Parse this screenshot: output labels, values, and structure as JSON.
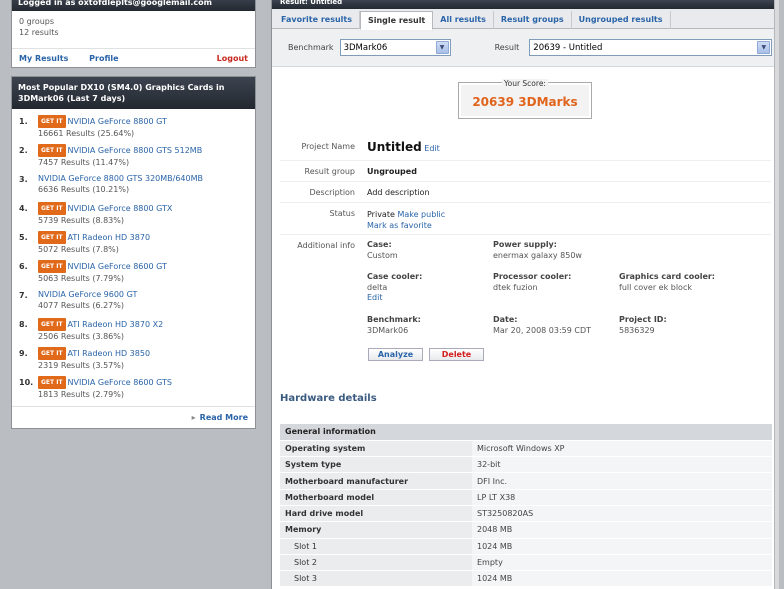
{
  "user": {
    "logged_in_text": "Logged in as oxtofdleplts@googlemail.com",
    "groups": "0 groups",
    "results": "12 results",
    "my_results": "My Results",
    "profile": "Profile",
    "logout": "Logout"
  },
  "popular": {
    "title_line1": "Most Popular DX10 (SM4.0) Graphics Cards in",
    "title_line2": "3DMark06 (Last 7 days)",
    "getit_label": "GET IT",
    "items": [
      {
        "num": "1.",
        "name": "NVIDIA GeForce 8800 GT",
        "count": "16661 Results (25.64%)",
        "getit": true
      },
      {
        "num": "2.",
        "name": "NVIDIA GeForce 8800 GTS 512MB",
        "count": "7457 Results (11.47%)",
        "getit": true
      },
      {
        "num": "3.",
        "name": "NVIDIA GeForce 8800 GTS 320MB/640MB",
        "count": "6636 Results (10.21%)",
        "getit": false
      },
      {
        "num": "4.",
        "name": "NVIDIA GeForce 8800 GTX",
        "count": "5739 Results (8.83%)",
        "getit": true
      },
      {
        "num": "5.",
        "name": "ATI Radeon HD 3870",
        "count": "5072 Results (7.8%)",
        "getit": true
      },
      {
        "num": "6.",
        "name": "NVIDIA GeForce 8600 GT",
        "count": "5063 Results (7.79%)",
        "getit": true
      },
      {
        "num": "7.",
        "name": "NVIDIA GeForce 9600 GT",
        "count": "4077 Results (6.27%)",
        "getit": false
      },
      {
        "num": "8.",
        "name": "ATI Radeon HD 3870 X2",
        "count": "2506 Results (3.86%)",
        "getit": true
      },
      {
        "num": "9.",
        "name": "ATI Radeon HD 3850",
        "count": "2319 Results (3.57%)",
        "getit": true
      },
      {
        "num": "10.",
        "name": "NVIDIA GeForce 8600 GTS",
        "count": "1813 Results (2.79%)",
        "getit": true
      }
    ],
    "read_more": "Read More"
  },
  "result": {
    "window_title": "Result: Untitled",
    "tabs": [
      "Favorite results",
      "Single result",
      "All results",
      "Result groups",
      "Ungrouped results"
    ],
    "active_tab": "Single result",
    "benchmark_label": "Benchmark",
    "benchmark_value": "3DMark06",
    "result_label": "Result",
    "result_value": "20639 - Untitled",
    "score_label": "Your Score:",
    "score_value": "20639 3DMarks",
    "project_name_label": "Project Name",
    "project_name": "Untitled",
    "edit": "Edit",
    "result_group_label": "Result group",
    "result_group": "Ungrouped",
    "description_label": "Description",
    "add_description": "Add description",
    "status_label": "Status",
    "status_value": "Private",
    "make_public": "Make public",
    "mark_favorite": "Mark as favorite",
    "additional_info_label": "Additional info",
    "case_k": "Case:",
    "case_v": "Custom",
    "psu_k": "Power supply:",
    "psu_v": "enermax galaxy 850w",
    "cooler_k": "Case cooler:",
    "cooler_v": "delta",
    "cooler_edit": "Edit",
    "cpu_cooler_k": "Processor cooler:",
    "cpu_cooler_v": "dtek fuzion",
    "gpu_cooler_k": "Graphics card cooler:",
    "gpu_cooler_v": "full cover ek block",
    "bench_k": "Benchmark:",
    "bench_v": "3DMark06",
    "date_k": "Date:",
    "date_v": "Mar 20, 2008 03:59 CDT",
    "pid_k": "Project ID:",
    "pid_v": "5836329",
    "analyze": "Analyze",
    "delete": "Delete"
  },
  "hardware": {
    "title": "Hardware details",
    "section": "General information",
    "rows": [
      {
        "k": "Operating system",
        "v": "Microsoft Windows XP",
        "sub": false
      },
      {
        "k": "System type",
        "v": "32-bit",
        "sub": false
      },
      {
        "k": "Motherboard manufacturer",
        "v": "DFI Inc.",
        "sub": false
      },
      {
        "k": "Motherboard model",
        "v": "LP LT X38",
        "sub": false
      },
      {
        "k": "Hard drive model",
        "v": "ST3250820AS",
        "sub": false
      },
      {
        "k": "Memory",
        "v": "2048 MB",
        "sub": false
      },
      {
        "k": "Slot 1",
        "v": "1024 MB",
        "sub": true
      },
      {
        "k": "Slot 2",
        "v": "Empty",
        "sub": true
      },
      {
        "k": "Slot 3",
        "v": "1024 MB",
        "sub": true
      }
    ]
  },
  "colors": {
    "accent": "#2a64a8",
    "score": "#e1641c",
    "getit": "#e06a1a",
    "delete": "#d41c1c"
  }
}
